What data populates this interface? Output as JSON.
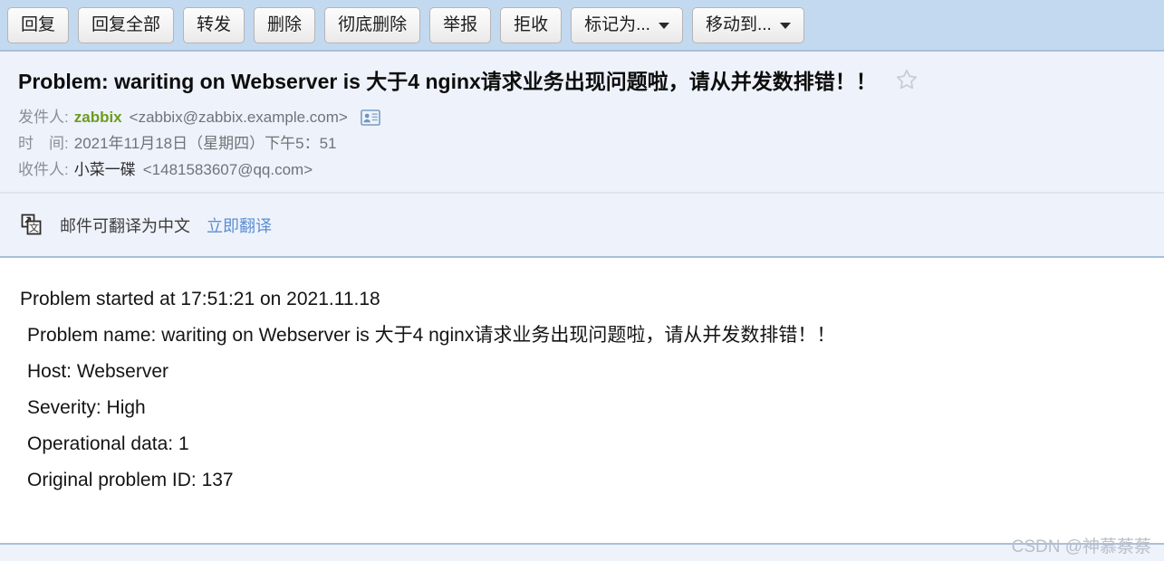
{
  "toolbar": {
    "buttons": [
      {
        "label": "回复",
        "dropdown": false
      },
      {
        "label": "回复全部",
        "dropdown": false
      },
      {
        "label": "转发",
        "dropdown": false
      },
      {
        "label": "删除",
        "dropdown": false
      },
      {
        "label": "彻底删除",
        "dropdown": false
      },
      {
        "label": "举报",
        "dropdown": false
      },
      {
        "label": "拒收",
        "dropdown": false
      },
      {
        "label": "标记为...",
        "dropdown": true
      },
      {
        "label": "移动到...",
        "dropdown": true
      }
    ]
  },
  "mail": {
    "subject": "Problem: wariting on Webserver is 大于4 nginx请求业务出现问题啦，请从并发数排错！！",
    "star_icon": "star-outline-icon",
    "from": {
      "label": "发件人:",
      "name": "zabbix",
      "address": "<zabbix@zabbix.example.com>",
      "contact_icon": "contact-card-icon"
    },
    "time": {
      "label": "时　间:",
      "value": "2021年11月18日（星期四）下午5：51"
    },
    "to": {
      "label": "收件人:",
      "name": "小菜一碟",
      "address": "<1481583607@qq.com>"
    }
  },
  "translate_bar": {
    "icon": "translate-icon",
    "text": "邮件可翻译为中文",
    "link": "立即翻译"
  },
  "body": {
    "lines": [
      "Problem started at 17:51:21 on 2021.11.18",
      "Problem name: wariting on Webserver is 大于4 nginx请求业务出现问题啦，请从并发数排错！！",
      "Host: Webserver",
      "Severity: High",
      "Operational data: 1",
      "Original problem ID: 137"
    ]
  },
  "watermark": {
    "text": "CSDN @神慕蔡蔡"
  },
  "colors": {
    "toolbar_bg": "#c3d9f0",
    "header_bg": "#eef2fa",
    "body_bg": "#ffffff",
    "sender_green": "#6d9b1f",
    "link_blue": "#5b8fd4",
    "divider": "#a8c0da"
  }
}
